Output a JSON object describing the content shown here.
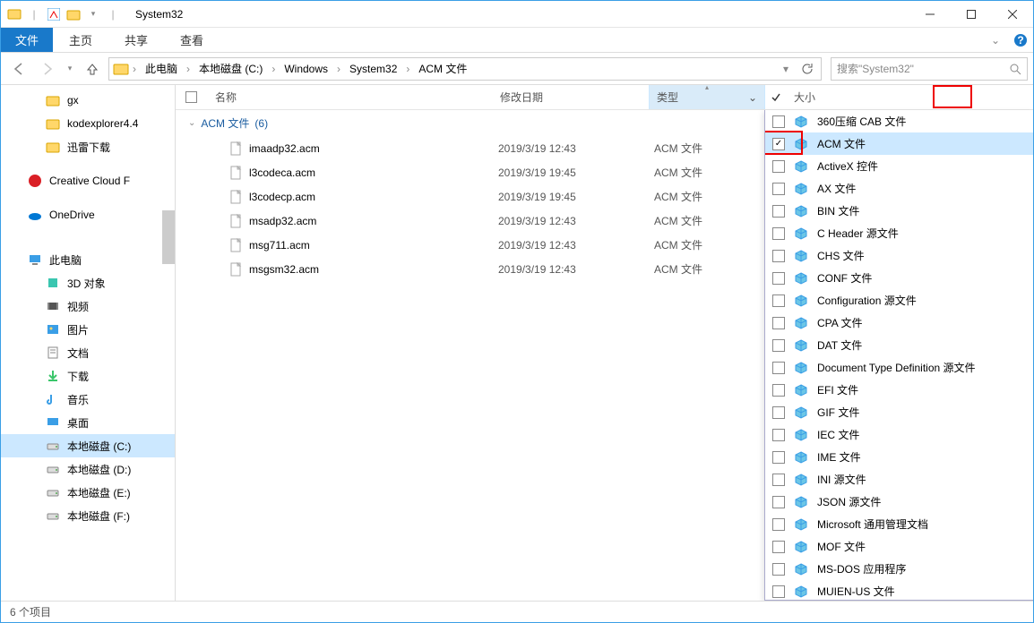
{
  "window": {
    "title": "System32"
  },
  "ribbon": {
    "file": "文件",
    "tabs": [
      "主页",
      "共享",
      "查看"
    ]
  },
  "breadcrumb": [
    "此电脑",
    "本地磁盘 (C:)",
    "Windows",
    "System32",
    "ACM 文件"
  ],
  "search": {
    "placeholder": "搜索\"System32\""
  },
  "sidebar": {
    "top": [
      {
        "label": "gx",
        "icon": "folder"
      },
      {
        "label": "kodexplorer4.4",
        "icon": "folder"
      },
      {
        "label": "迅雷下载",
        "icon": "folder"
      }
    ],
    "groups": [
      {
        "label": "Creative Cloud F",
        "icon": "cc"
      },
      {
        "label": "OneDrive",
        "icon": "onedrive"
      }
    ],
    "thispc": {
      "label": "此电脑",
      "children": [
        {
          "label": "3D 对象",
          "icon": "3d"
        },
        {
          "label": "视频",
          "icon": "video"
        },
        {
          "label": "图片",
          "icon": "pictures"
        },
        {
          "label": "文档",
          "icon": "documents"
        },
        {
          "label": "下载",
          "icon": "downloads"
        },
        {
          "label": "音乐",
          "icon": "music"
        },
        {
          "label": "桌面",
          "icon": "desktop"
        },
        {
          "label": "本地磁盘 (C:)",
          "icon": "drive",
          "selected": true
        },
        {
          "label": "本地磁盘 (D:)",
          "icon": "drive"
        },
        {
          "label": "本地磁盘 (E:)",
          "icon": "drive"
        },
        {
          "label": "本地磁盘 (F:)",
          "icon": "drive"
        }
      ]
    }
  },
  "columns": {
    "name": "名称",
    "date": "修改日期",
    "type": "类型",
    "size": "大小"
  },
  "group": {
    "label": "ACM 文件",
    "count": "(6)"
  },
  "files": [
    {
      "name": "imaadp32.acm",
      "date": "2019/3/19 12:43",
      "type": "ACM 文件"
    },
    {
      "name": "l3codeca.acm",
      "date": "2019/3/19 19:45",
      "type": "ACM 文件"
    },
    {
      "name": "l3codecp.acm",
      "date": "2019/3/19 19:45",
      "type": "ACM 文件"
    },
    {
      "name": "msadp32.acm",
      "date": "2019/3/19 12:43",
      "type": "ACM 文件"
    },
    {
      "name": "msg711.acm",
      "date": "2019/3/19 12:43",
      "type": "ACM 文件"
    },
    {
      "name": "msgsm32.acm",
      "date": "2019/3/19 12:43",
      "type": "ACM 文件"
    }
  ],
  "typefilter": [
    {
      "label": "360压缩 CAB 文件",
      "checked": false
    },
    {
      "label": "ACM 文件",
      "checked": true,
      "highlight": true
    },
    {
      "label": "ActiveX 控件",
      "checked": false
    },
    {
      "label": "AX 文件",
      "checked": false
    },
    {
      "label": "BIN 文件",
      "checked": false
    },
    {
      "label": "C Header 源文件",
      "checked": false
    },
    {
      "label": "CHS 文件",
      "checked": false
    },
    {
      "label": "CONF 文件",
      "checked": false
    },
    {
      "label": "Configuration 源文件",
      "checked": false
    },
    {
      "label": "CPA 文件",
      "checked": false
    },
    {
      "label": "DAT 文件",
      "checked": false
    },
    {
      "label": "Document Type Definition 源文件",
      "checked": false
    },
    {
      "label": "EFI 文件",
      "checked": false
    },
    {
      "label": "GIF 文件",
      "checked": false
    },
    {
      "label": "IEC 文件",
      "checked": false
    },
    {
      "label": "IME 文件",
      "checked": false
    },
    {
      "label": "INI 源文件",
      "checked": false
    },
    {
      "label": "JSON 源文件",
      "checked": false
    },
    {
      "label": "Microsoft 通用管理文档",
      "checked": false
    },
    {
      "label": "MOF 文件",
      "checked": false
    },
    {
      "label": "MS-DOS 应用程序",
      "checked": false
    },
    {
      "label": "MUIEN-US 文件",
      "checked": false
    }
  ],
  "status": "6 个项目"
}
